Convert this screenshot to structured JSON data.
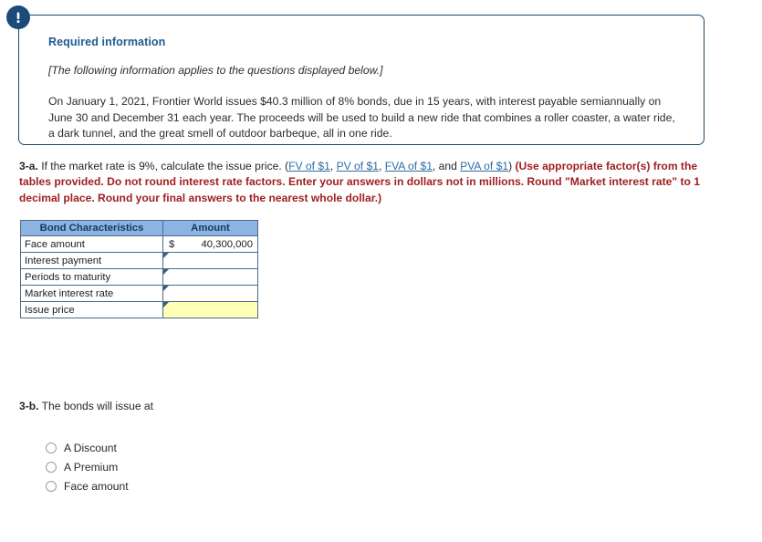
{
  "info_box": {
    "icon": "exclamation-circle-icon",
    "title": "Required information",
    "italic_note": "[The following information applies to the questions displayed below.]",
    "body": "On January 1, 2021, Frontier World issues $40.3 million of 8% bonds, due in 15 years, with interest payable semiannually on June 30 and December 31 each year. The proceeds will be used to build a new ride that combines a roller coaster, a water ride, a dark tunnel, and the great smell of outdoor barbeque, all in one ride.",
    "border_color": "#1f4662",
    "title_color": "#1d5a8e"
  },
  "question_3a": {
    "label": "3-a.",
    "text_before_links": "If the market rate is 9%, calculate the issue price. (",
    "links": [
      "FV of $1",
      "PV of $1",
      "FVA of $1",
      "PVA of $1"
    ],
    "link_separator": ", ",
    "link_conjunction": ", and ",
    "text_after_links": ")",
    "bold_red": "(Use appropriate factor(s) from the tables provided. Do not round interest rate factors. Enter your answers in dollars not in millions. Round \"Market interest rate\" to 1 decimal place. Round your final answers to the nearest whole dollar.)",
    "link_color": "#2e6da4",
    "bold_red_color": "#a02020"
  },
  "bond_table": {
    "headers": [
      "Bond Characteristics",
      "Amount"
    ],
    "header_bg": "#8db3e2",
    "highlight_bg": "#ffffb5",
    "rows": [
      {
        "label": "Face amount",
        "currency": "$",
        "value": "40,300,000",
        "editable": false,
        "highlight": false
      },
      {
        "label": "Interest payment",
        "currency": "",
        "value": "",
        "editable": true,
        "highlight": false
      },
      {
        "label": "Periods to maturity",
        "currency": "",
        "value": "",
        "editable": true,
        "highlight": false
      },
      {
        "label": "Market interest rate",
        "currency": "",
        "value": "",
        "editable": true,
        "highlight": false
      },
      {
        "label": "Issue price",
        "currency": "",
        "value": "",
        "editable": true,
        "highlight": true
      }
    ]
  },
  "question_3b": {
    "label": "3-b.",
    "text": "The bonds will issue at",
    "options": [
      "A Discount",
      "A Premium",
      "Face amount"
    ],
    "selected": null
  }
}
